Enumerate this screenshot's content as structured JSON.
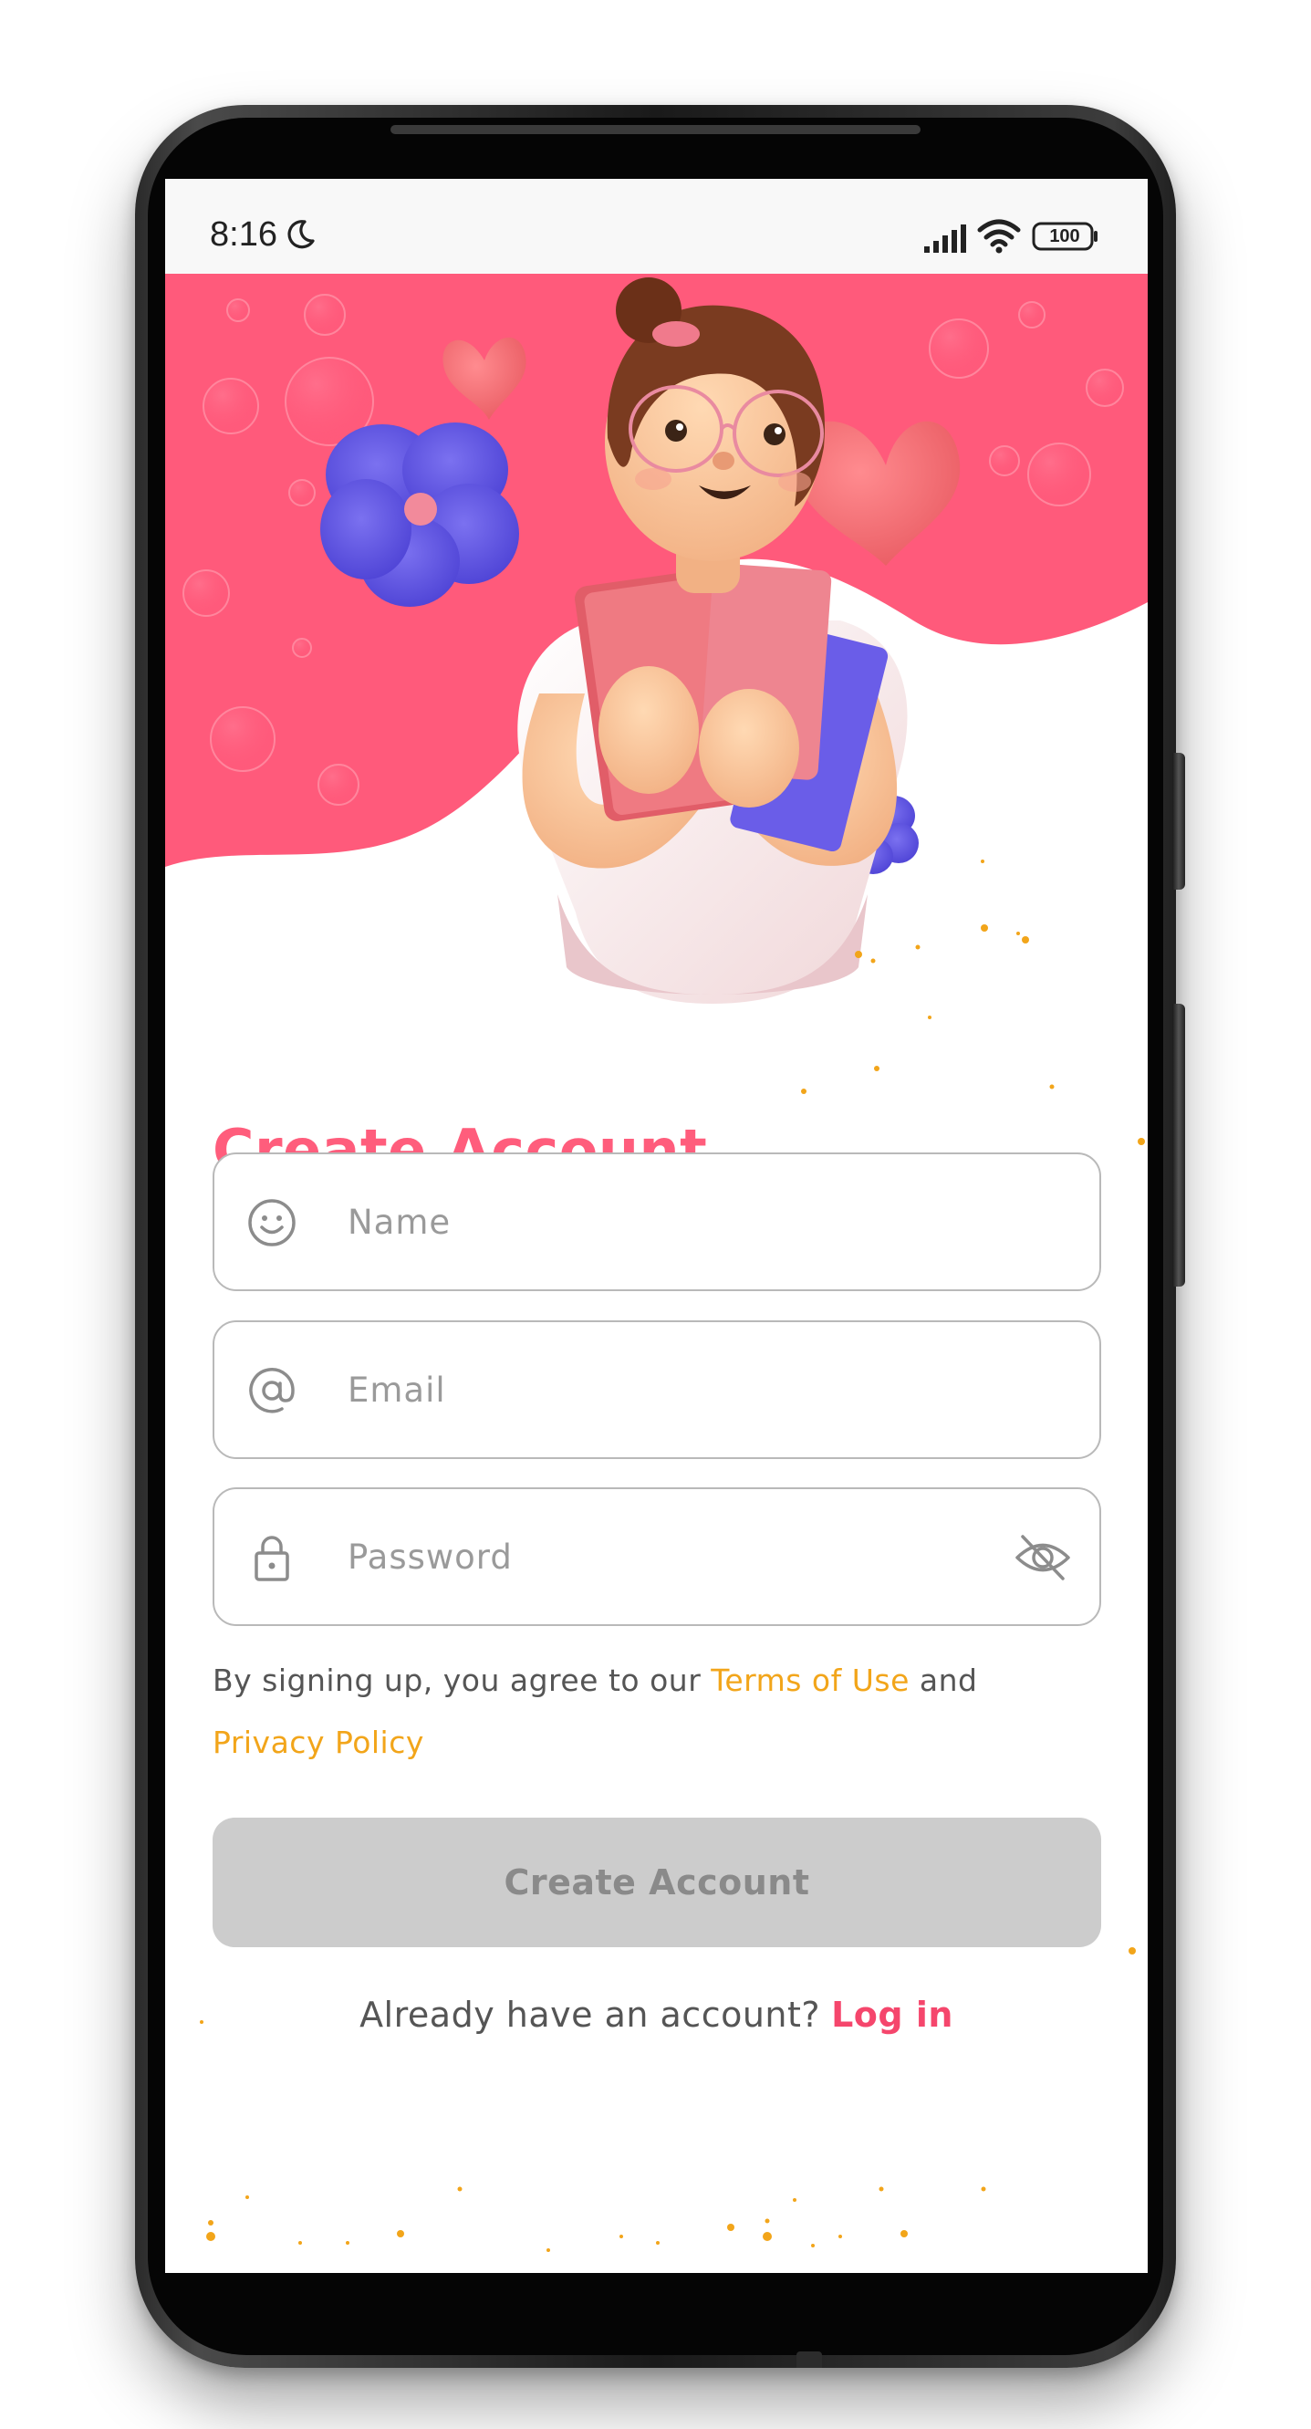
{
  "status_bar": {
    "time": "8:16",
    "battery": "100",
    "icons": [
      "moon-icon",
      "signal-icon",
      "wifi-icon",
      "battery-icon"
    ]
  },
  "hero": {
    "illustration": "woman-holding-books-illustration",
    "background_color": "#ff5a7b"
  },
  "page": {
    "title": "Create Account"
  },
  "form": {
    "name": {
      "placeholder": "Name",
      "value": "",
      "icon": "smiley-icon"
    },
    "email": {
      "placeholder": "Email",
      "value": "",
      "icon": "at-sign-icon"
    },
    "password": {
      "placeholder": "Password",
      "value": "",
      "icon": "lock-icon",
      "toggle_icon": "eye-off-icon"
    }
  },
  "terms": {
    "prefix": "By signing up, you agree to our ",
    "terms_link": "Terms of Use",
    "middle": " and",
    "privacy_link": "Privacy Policy"
  },
  "submit": {
    "label": "Create Account",
    "enabled": false
  },
  "login": {
    "prompt": "Already have an account?",
    "link": "Log in"
  },
  "colors": {
    "primary": "#ff5d7c",
    "link_accent": "#f2a51a",
    "login_link": "#f5466c",
    "button_disabled": "#cccccc"
  }
}
